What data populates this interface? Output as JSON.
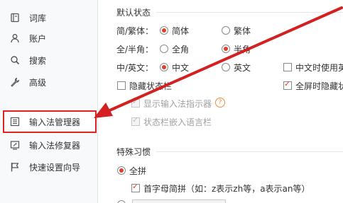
{
  "sidebar": {
    "items": [
      {
        "label": "词库",
        "icon": "book-icon"
      },
      {
        "label": "账户",
        "icon": "user-icon"
      },
      {
        "label": "搜索",
        "icon": "search-icon"
      },
      {
        "label": "高级",
        "icon": "wrench-icon"
      },
      {
        "label": "输入法管理器",
        "icon": "list-icon",
        "active": true
      },
      {
        "label": "输入法修复器",
        "icon": "repair-icon"
      },
      {
        "label": "快速设置向导",
        "icon": "flag-icon"
      }
    ]
  },
  "default_state": {
    "title": "默认状态",
    "row1": {
      "label": "简/繁体：",
      "opt1": "简体",
      "opt2": "繁体",
      "selected": "简体"
    },
    "row2": {
      "label": "全/半角：",
      "opt1": "全角",
      "opt2": "半角",
      "selected": "半角"
    },
    "row3": {
      "label": "中/英文：",
      "opt1": "中文",
      "opt2": "英文",
      "selected": "中文",
      "extra": "中文时使用英"
    },
    "hide_statusbar": {
      "label": "隐藏状态栏",
      "checked": false
    },
    "fullscreen_hide": {
      "label": "全屏时隐藏状",
      "checked": true
    },
    "show_indicator": {
      "label": "显示输入法指示器",
      "checked": true,
      "disabled": true
    },
    "embed_lang_bar": {
      "label": "状态栏嵌入语言栏",
      "checked": true,
      "disabled": true
    }
  },
  "special_habits": {
    "title": "特殊习惯",
    "full_pinyin": {
      "label": "全拼",
      "selected": true
    },
    "initial_abbrev": {
      "label": "首字母简拼（如：z表示zh等，a表示an等）",
      "checked": true
    }
  },
  "colors": {
    "accent": "#e0402a",
    "highlight_border": "#e02323",
    "arrow": "#d42020"
  }
}
